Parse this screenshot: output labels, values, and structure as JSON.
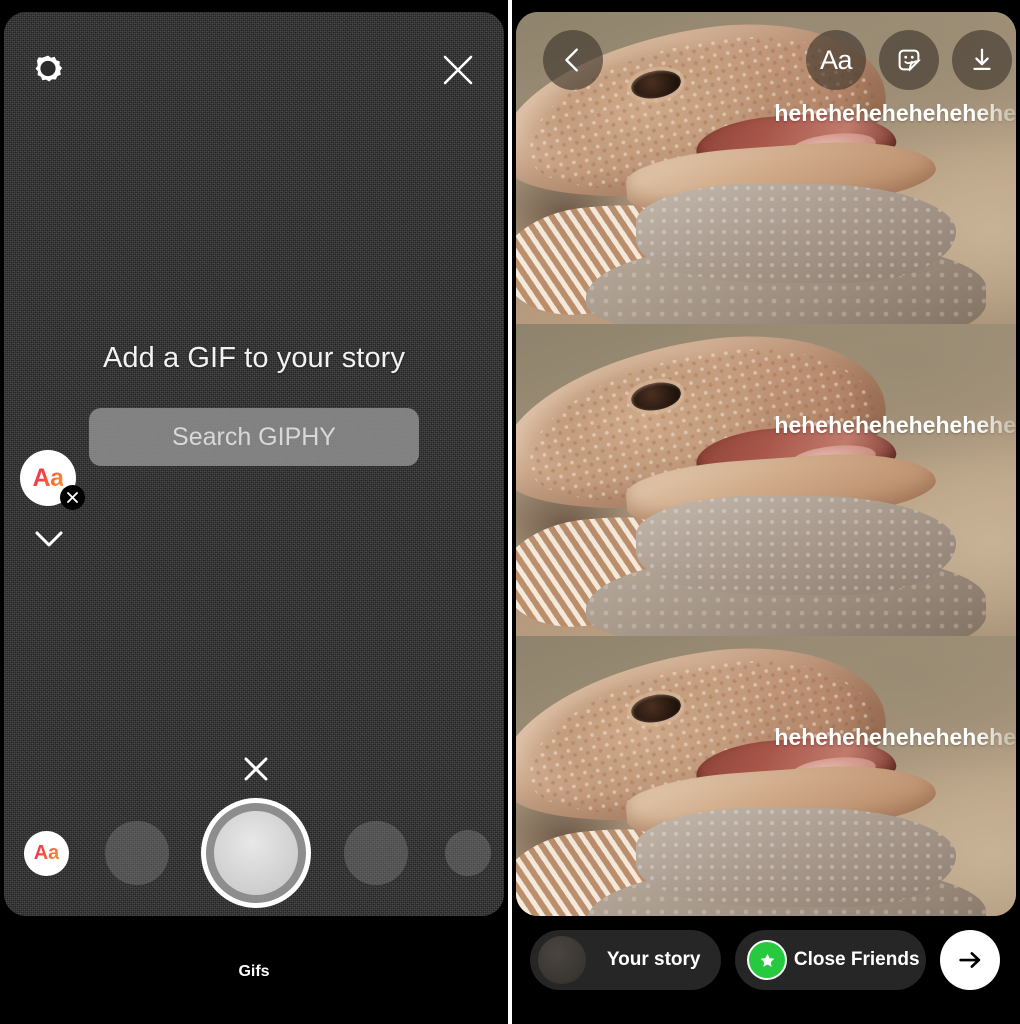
{
  "left_panel": {
    "settings_icon": "gear-icon",
    "close_icon": "close-icon",
    "title": "Add a GIF to your story",
    "search_button_label": "Search GIPHY",
    "sticker": {
      "label": "Aa",
      "delete_icon": "close-icon"
    },
    "chevron_icon": "chevron-down-icon",
    "camera": {
      "close_icon": "close-icon",
      "shutter": "shutter-button",
      "text_mode_label": "Aa"
    },
    "footer_label": "Gifs"
  },
  "right_panel": {
    "back_icon": "chevron-left-icon",
    "tools": [
      {
        "name": "text-tool",
        "label": "Aa"
      },
      {
        "name": "sticker-tool",
        "label": ""
      },
      {
        "name": "save-tool",
        "label": ""
      }
    ],
    "overlay_text": "hehehehehehehehehe",
    "media": {
      "alt": "bearded dragon lizard with open mouth",
      "repeat_count": 3
    },
    "share": {
      "your_story_label": "Your story",
      "close_friends_label": "Close Friends",
      "send_icon": "arrow-right-icon"
    }
  },
  "colors": {
    "background": "#000000",
    "card": "#2b2b2b",
    "pill": "#262626",
    "close_friends_green": "#27c93f",
    "accent_text": "#ffffff",
    "search_button": "#929292"
  }
}
